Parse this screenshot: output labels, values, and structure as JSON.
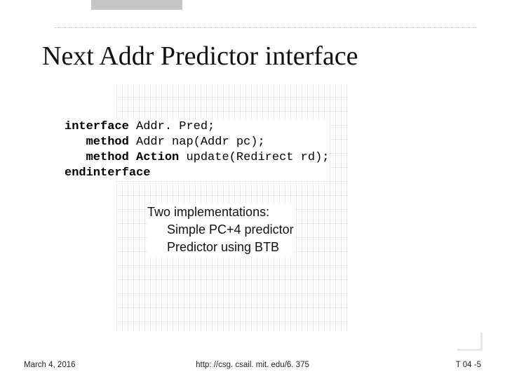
{
  "title": "Next Addr Predictor interface",
  "code": {
    "k_interface": "interface",
    "name": " Addr. Pred;",
    "k_method1": "method",
    "method1": " Addr nap(Addr pc);",
    "k_method2": "method",
    "k_action": "Action",
    "method2_rest": " update(Redirect rd);",
    "k_endinterface": "endinterface"
  },
  "impl": {
    "heading": "Two implementations:",
    "item1": "Simple PC+4 predictor",
    "item2": "Predictor using BTB"
  },
  "footer": {
    "left": "March 4, 2016",
    "center": "http: //csg. csail. mit. edu/6. 375",
    "right": "T 04 -5"
  }
}
